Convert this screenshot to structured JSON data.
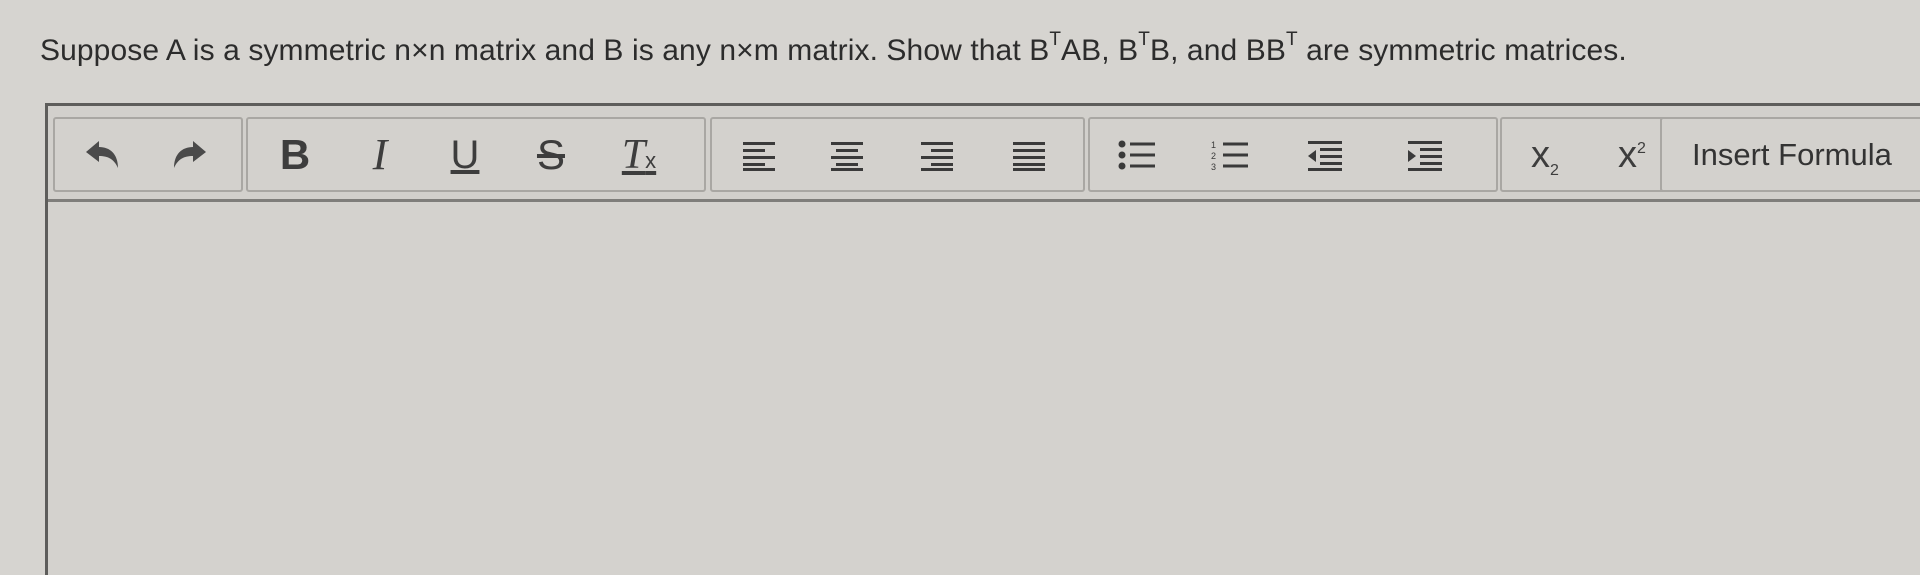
{
  "question": {
    "part1": "Suppose A is a symmetric n×n matrix and B is any n×m matrix. Show that B",
    "sup1": "T",
    "part2": "AB, B",
    "sup2": "T",
    "part3": "B, and BB",
    "sup3": "T",
    "part4": " are symmetric matrices."
  },
  "toolbar": {
    "undo_icon": "undo-icon",
    "redo_icon": "redo-icon",
    "bold_label": "B",
    "italic_label": "I",
    "underline_label": "U",
    "strike_label": "S",
    "clear_format_label": "T",
    "clear_format_sub": "x",
    "subscript_base": "x",
    "subscript_sub": "2",
    "superscript_base": "x",
    "superscript_sup": "2",
    "insert_formula_label": "Insert Formula"
  },
  "editor": {
    "content": ""
  }
}
